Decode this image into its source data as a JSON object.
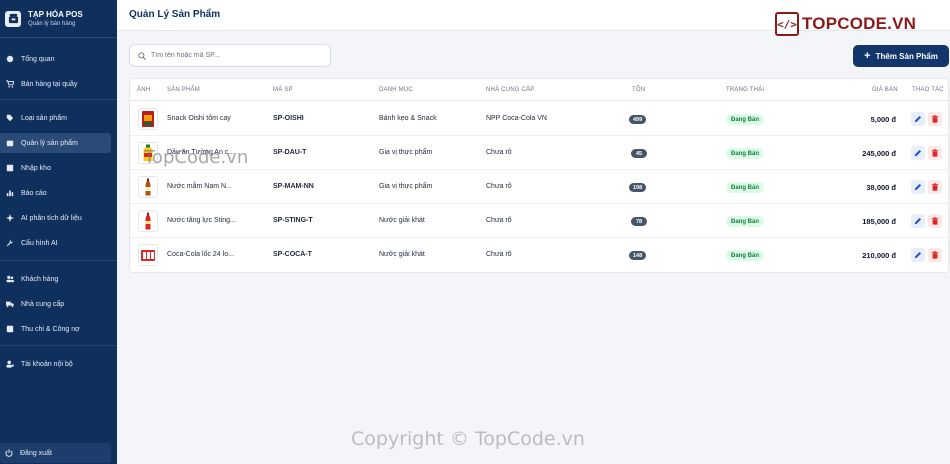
{
  "brand": {
    "title": "TẠP HÓA POS",
    "subtitle": "Quản lý bán hàng"
  },
  "nav": {
    "items": [
      {
        "label": "Tổng quan",
        "icon": "dashboard-icon"
      },
      {
        "label": "Bán hàng tại quầy",
        "icon": "cart-icon"
      },
      {
        "label": "Loại sản phẩm",
        "icon": "tag-icon"
      },
      {
        "label": "Quản lý sản phẩm",
        "icon": "box-icon",
        "active": true
      },
      {
        "label": "Nhập kho",
        "icon": "import-icon"
      },
      {
        "label": "Báo cáo",
        "icon": "chart-icon"
      },
      {
        "label": "AI phân tích dữ liệu",
        "icon": "sparkle-icon"
      },
      {
        "label": "Cấu hình AI",
        "icon": "wrench-icon"
      },
      {
        "label": "Khách hàng",
        "icon": "users-icon"
      },
      {
        "label": "Nhà cung cấp",
        "icon": "truck-icon"
      },
      {
        "label": "Thu chi & Công nợ",
        "icon": "wallet-icon"
      },
      {
        "label": "Tài khoản nội bộ",
        "icon": "user-cog-icon"
      }
    ],
    "logout": "Đăng xuất"
  },
  "header": {
    "title": "Quản Lý Sản Phẩm"
  },
  "logo": {
    "mark": "</>",
    "text": "TOPCODE.VN"
  },
  "toolbar": {
    "search_placeholder": "Tìm tên hoặc mã SP...",
    "add_label": "Thêm Sản Phẩm"
  },
  "table": {
    "headers": {
      "image": "ẢNH",
      "product": "SẢN PHẨM",
      "code": "MÃ SP",
      "category": "DANH MỤC",
      "supplier": "NHÀ CUNG CẤP",
      "stock": "TỒN",
      "status": "TRẠNG THÁI",
      "price": "GIÁ BÁN",
      "actions": "THAO TÁC"
    },
    "rows": [
      {
        "name": "Snack Oishi tôm cay",
        "code": "SP-OISHI",
        "category": "Bánh kẹo & Snack",
        "supplier": "NPP Coca-Cola VN",
        "stock": "499",
        "status": "Đang Bán",
        "price": "5,000 đ"
      },
      {
        "name": "Dầu ăn Tường An c...",
        "code": "SP-DAU-T",
        "category": "Gia vị thực phẩm",
        "supplier": "Chưa rõ",
        "stock": "45",
        "status": "Đang Bán",
        "price": "245,000 đ"
      },
      {
        "name": "Nước mắm Nam N...",
        "code": "SP-MAM-NN",
        "category": "Gia vị thực phẩm",
        "supplier": "Chưa rõ",
        "stock": "198",
        "status": "Đang Bán",
        "price": "38,000 đ"
      },
      {
        "name": "Nước tăng lực Sting...",
        "code": "SP-STING-T",
        "category": "Nước giải khát",
        "supplier": "Chưa rõ",
        "stock": "78",
        "status": "Đang Bán",
        "price": "185,000 đ"
      },
      {
        "name": "Coca-Cola lốc 24 lo...",
        "code": "SP-COCA-T",
        "category": "Nước giải khát",
        "supplier": "Chưa rõ",
        "stock": "148",
        "status": "Đang Bán",
        "price": "210,000 đ"
      }
    ]
  },
  "watermark": {
    "main": "Copyright © TopCode.vn",
    "overlay": "TopCode.vn"
  }
}
